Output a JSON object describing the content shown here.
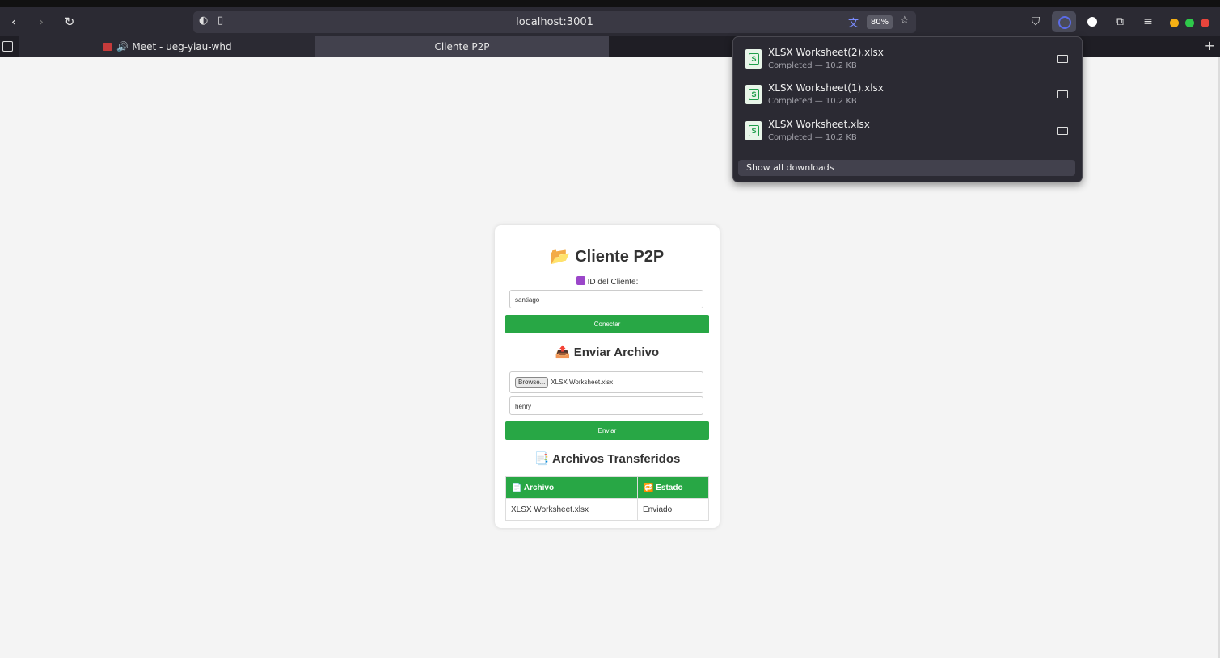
{
  "browser": {
    "url": "localhost:3001",
    "zoom": "80%",
    "tabs": [
      {
        "label": "Meet - ueg-yiau-whd"
      },
      {
        "label": "Cliente P2P"
      }
    ],
    "icons": {
      "back": "‹",
      "forward": "›",
      "reload": "↻",
      "translate": "文",
      "star": "☆",
      "pocket": "⛉",
      "extensions": "⧉",
      "menu": "≡",
      "plus": "+"
    }
  },
  "downloads": {
    "items": [
      {
        "name": "XLSX Worksheet(2).xlsx",
        "status": "Completed — 10.2 KB"
      },
      {
        "name": "XLSX Worksheet(1).xlsx",
        "status": "Completed — 10.2 KB"
      },
      {
        "name": "XLSX Worksheet.xlsx",
        "status": "Completed — 10.2 KB"
      }
    ],
    "show_all": "Show all downloads"
  },
  "app": {
    "title_emoji": "📂",
    "title": "Cliente P2P",
    "id_label": "ID del Cliente:",
    "id_value": "santiago",
    "connect_label": "Conectar",
    "send_emoji": "📤",
    "send_title": "Enviar Archivo",
    "browse_label": "Browse...",
    "file_name": "XLSX Worksheet.xlsx",
    "recipient_value": "henry",
    "send_label": "Enviar",
    "transfers_emoji": "📑",
    "transfers_title": "Archivos Transferidos",
    "table": {
      "headers": [
        "📄 Archivo",
        "🔁 Estado"
      ],
      "rows": [
        [
          "XLSX Worksheet.xlsx",
          "Enviado"
        ]
      ]
    }
  }
}
